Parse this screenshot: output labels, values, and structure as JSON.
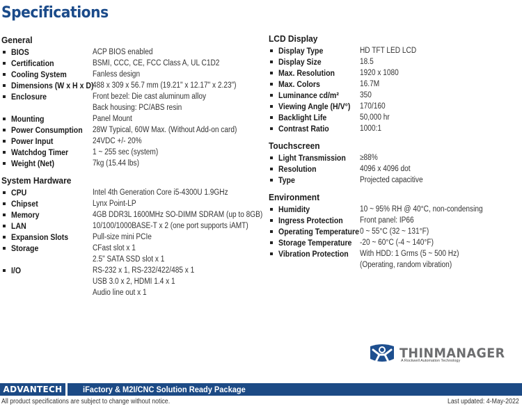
{
  "page": {
    "title": "Specifications"
  },
  "left_sections": [
    {
      "title": "General",
      "items": [
        {
          "label": "BIOS",
          "value": [
            "ACP BIOS enabled"
          ]
        },
        {
          "label": "Certification",
          "value": [
            "BSMI, CCC, CE, FCC Class A, UL C1D2"
          ]
        },
        {
          "label": "Cooling System",
          "value": [
            "Fanless design"
          ]
        },
        {
          "label": "Dimensions (W x H x D)",
          "value": [
            "488 x 309 x 56.7 mm (19.21\" x 12.17\" x 2.23\")"
          ]
        },
        {
          "label": "Enclosure",
          "value": [
            "Front bezel: Die cast aluminum alloy",
            "Back housing: PC/ABS resin"
          ]
        },
        {
          "label": "Mounting",
          "value": [
            "Panel Mount"
          ]
        },
        {
          "label": "Power Consumption",
          "value": [
            "28W Typical, 60W Max. (Without Add-on card)"
          ]
        },
        {
          "label": "Power Input",
          "value": [
            "24VDC +/- 20%"
          ]
        },
        {
          "label": "Watchdog Timer",
          "value": [
            "1 ~ 255 sec (system)"
          ]
        },
        {
          "label": "Weight (Net)",
          "value": [
            "7kg (15.44 lbs)"
          ]
        }
      ]
    },
    {
      "title": "System Hardware",
      "items": [
        {
          "label": "CPU",
          "value": [
            "Intel 4th Generation Core i5-4300U 1.9GHz"
          ]
        },
        {
          "label": "Chipset",
          "value": [
            "Lynx Point-LP"
          ]
        },
        {
          "label": "Memory",
          "value": [
            "4GB DDR3L 1600MHz SO-DIMM SDRAM (up to 8GB)"
          ]
        },
        {
          "label": "LAN",
          "value": [
            "10/100/1000BASE-T x 2 (one port supports iAMT)"
          ]
        },
        {
          "label": "Expansion Slots",
          "value": [
            "Pull-size mini PCIe"
          ]
        },
        {
          "label": "Storage",
          "value": [
            "CFast slot x 1",
            "2.5\" SATA SSD slot x 1"
          ]
        },
        {
          "label": "I/O",
          "value": [
            "RS-232 x 1, RS-232/422/485 x 1",
            "USB 3.0 x 2, HDMI 1.4 x 1",
            "Audio line out x 1"
          ]
        }
      ]
    }
  ],
  "right_sections": [
    {
      "title": "LCD Display",
      "items": [
        {
          "label": "Display Type",
          "value": [
            "HD TFT LED LCD"
          ]
        },
        {
          "label": "Display Size",
          "value": [
            "18.5"
          ]
        },
        {
          "label": "Max. Resolution",
          "value": [
            "1920 x 1080"
          ]
        },
        {
          "label": "Max. Colors",
          "value": [
            "16.7M"
          ]
        },
        {
          "label": "Luminance cd/m²",
          "value": [
            "350"
          ]
        },
        {
          "label": "Viewing Angle (H/V°)",
          "value": [
            "170/160"
          ]
        },
        {
          "label": "Backlight Life",
          "value": [
            "50,000 hr"
          ]
        },
        {
          "label": "Contrast Ratio",
          "value": [
            "1000:1"
          ]
        }
      ]
    },
    {
      "title": "Touchscreen",
      "items": [
        {
          "label": "Light Transmission",
          "value": [
            "≥88%"
          ]
        },
        {
          "label": "Resolution",
          "value": [
            "4096 x 4096 dot"
          ]
        },
        {
          "label": "Type",
          "value": [
            "Projected capacitive"
          ]
        }
      ]
    },
    {
      "title": "Environment",
      "items": [
        {
          "label": "Humidity",
          "value": [
            "10 ~ 95% RH @ 40°C, non-condensing"
          ]
        },
        {
          "label": "Ingress Protection",
          "value": [
            "Front panel: IP66"
          ]
        },
        {
          "label": "Operating Temperature",
          "value": [
            "0 ~ 55°C (32 ~ 131°F)"
          ]
        },
        {
          "label": "Storage Temperature",
          "value": [
            "-20 ~ 60°C (-4 ~ 140°F)"
          ]
        },
        {
          "label": "Vibration Protection",
          "value": [
            "With HDD: 1 Grms (5 ~ 500 Hz)",
            "(Operating, random vibration)"
          ]
        }
      ]
    }
  ],
  "logo": {
    "name": "THINMANAGER",
    "tagline": "A Rockwell Automation Technology",
    "icon": "thinmanager-person-icon"
  },
  "footer": {
    "brand": "ADVANTECH",
    "title": "iFactory & M2I/CNC Solution Ready Package",
    "disclaimer": "All product specifications are subject to change without notice.",
    "updated": "Last updated: 4-May-2022"
  },
  "colors": {
    "brand_blue": "#1c4a85",
    "title_blue": "#1b4b8a",
    "logo_gray": "#6d6e70"
  }
}
